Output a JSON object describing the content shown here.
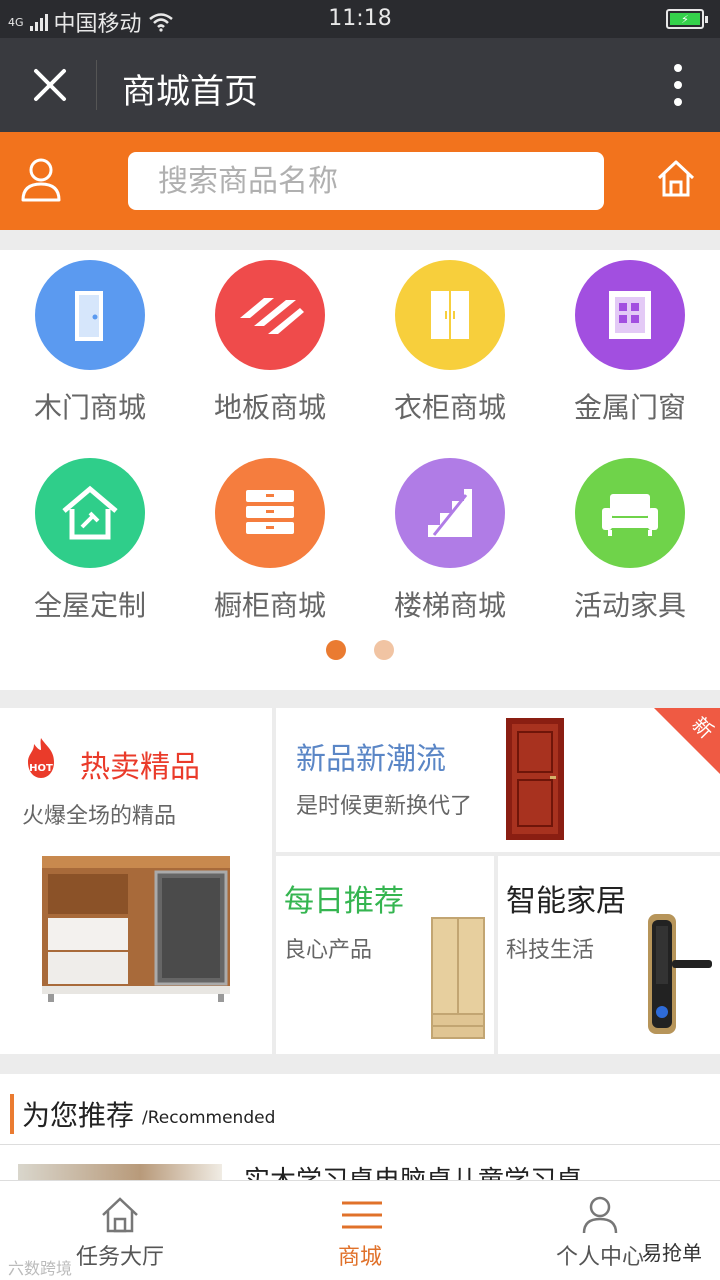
{
  "status_bar": {
    "network": "4G",
    "carrier": "中国移动",
    "time": "11:18",
    "battery_icon": "battery-charging-icon"
  },
  "title_bar": {
    "title": "商城首页",
    "close_icon": "close-icon",
    "more_icon": "more-vertical-icon"
  },
  "search": {
    "placeholder": "搜索商品名称",
    "value": ""
  },
  "categories": [
    {
      "label": "木门商城",
      "icon": "door-icon",
      "color": "#5b9af0"
    },
    {
      "label": "地板商城",
      "icon": "floor-icon",
      "color": "#ef4b4b"
    },
    {
      "label": "衣柜商城",
      "icon": "wardrobe-icon",
      "color": "#f7cf3c"
    },
    {
      "label": "金属门窗",
      "icon": "window-icon",
      "color": "#a24fe0"
    },
    {
      "label": "全屋定制",
      "icon": "house-icon",
      "color": "#2fce8a"
    },
    {
      "label": "橱柜商城",
      "icon": "cabinet-icon",
      "color": "#f57d3e"
    },
    {
      "label": "楼梯商城",
      "icon": "stairs-icon",
      "color": "#b07ce6"
    },
    {
      "label": "活动家具",
      "icon": "sofa-icon",
      "color": "#6fd34a"
    }
  ],
  "carousel": {
    "pages": 2,
    "active": 1
  },
  "promos": {
    "hot": {
      "badge": "HOT",
      "title": "热卖精品",
      "subtitle": "火爆全场的精品"
    },
    "new": {
      "title": "新品新潮流",
      "subtitle": "是时候更新换代了",
      "corner": "新"
    },
    "daily": {
      "title": "每日推荐",
      "subtitle": "良心产品"
    },
    "smart": {
      "title": "智能家居",
      "subtitle": "科技生活"
    }
  },
  "recommend": {
    "title": "为您推荐",
    "title_en": "/Recommended",
    "first_product": "实木学习桌电脑桌儿童学习桌"
  },
  "bottom_nav": [
    {
      "label": "任务大厅",
      "icon": "home-outline-icon"
    },
    {
      "label": "商城",
      "icon": "menu-lines-icon"
    },
    {
      "label": "个人中心",
      "icon": "person-icon"
    }
  ],
  "watermarks": {
    "left": "六数跨境",
    "right": "易抢单"
  },
  "colors": {
    "accent": "#f2731d",
    "title_bar": "#393a3f",
    "status_bar": "#2a2b2f",
    "active_tab": "#e0712a"
  }
}
